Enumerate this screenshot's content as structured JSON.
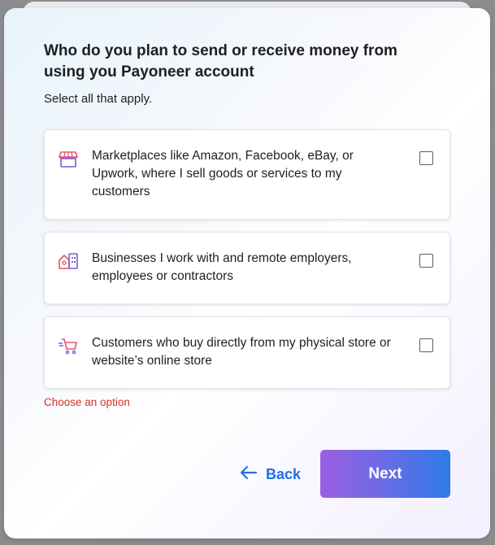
{
  "dialog": {
    "title": "Who do you plan to send or receive money from using you Payoneer account",
    "subtitle": "Select all that apply."
  },
  "options": [
    {
      "label": "Marketplaces like Amazon, Facebook, eBay, or Upwork, where I sell goods or services to my customers",
      "icon": "storefront-icon",
      "checked": false
    },
    {
      "label": "Businesses I work with and remote employers, employees or contractors",
      "icon": "buildings-icon",
      "checked": false
    },
    {
      "label": "Customers who buy directly from my physical store or website’s online store",
      "icon": "shopping-cart-icon",
      "checked": false
    }
  ],
  "error": "Choose an option",
  "buttons": {
    "back_label": "Back",
    "next_label": "Next"
  },
  "colors": {
    "accent_blue": "#2170e8",
    "error_red": "#d93025",
    "icon_pink": "#e8546e",
    "icon_purple": "#7b5be0",
    "next_gradient_start": "#9a5fe0",
    "next_gradient_end": "#2f7ae8"
  }
}
